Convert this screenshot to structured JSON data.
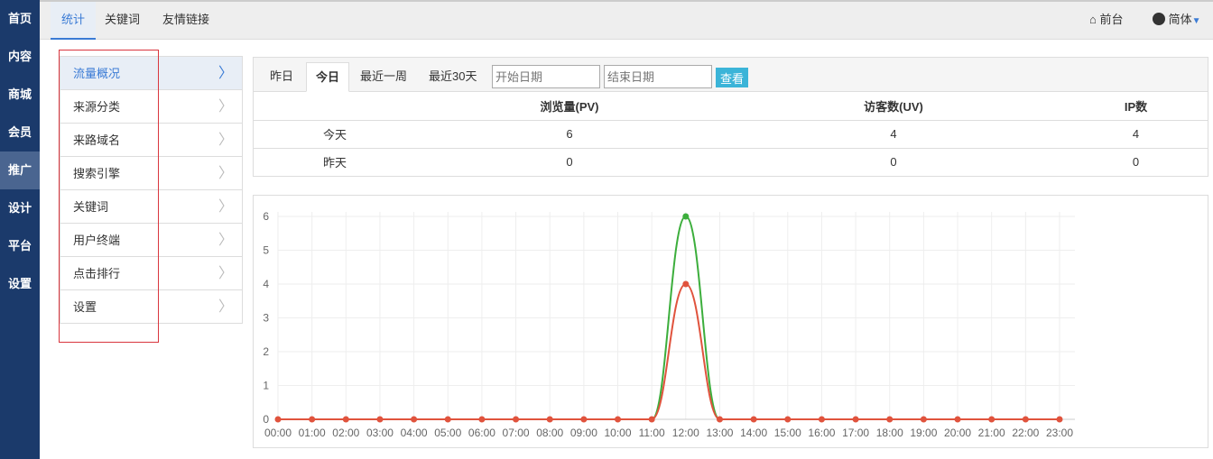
{
  "sidebar": {
    "items": [
      "首页",
      "内容",
      "商城",
      "会员",
      "推广",
      "设计",
      "平台",
      "设置"
    ],
    "active": 4
  },
  "topbar": {
    "tabs": [
      "统计",
      "关键词",
      "友情链接"
    ],
    "frontend": "前台",
    "language": "简体"
  },
  "menu": {
    "items": [
      "流量概况",
      "来源分类",
      "来路域名",
      "搜索引擎",
      "关键词",
      "用户终端",
      "点击排行",
      "设置"
    ]
  },
  "filter": {
    "tabs": [
      "昨日",
      "今日",
      "最近一周",
      "最近30天"
    ],
    "active": 1,
    "start_placeholder": "开始日期",
    "end_placeholder": "结束日期",
    "view_button": "查看"
  },
  "table": {
    "headers": [
      "",
      "浏览量(PV)",
      "访客数(UV)",
      "IP数"
    ],
    "rows": [
      [
        "今天",
        "6",
        "4",
        "4"
      ],
      [
        "昨天",
        "0",
        "0",
        "0"
      ]
    ]
  },
  "chart_data": {
    "type": "line",
    "x": [
      "00:00",
      "01:00",
      "02:00",
      "03:00",
      "04:00",
      "05:00",
      "06:00",
      "07:00",
      "08:00",
      "09:00",
      "10:00",
      "11:00",
      "12:00",
      "13:00",
      "14:00",
      "15:00",
      "16:00",
      "17:00",
      "18:00",
      "19:00",
      "20:00",
      "21:00",
      "22:00",
      "23:00"
    ],
    "ylim": [
      0,
      6
    ],
    "yticks": [
      0,
      1,
      2,
      3,
      4,
      5,
      6
    ],
    "grid": true,
    "series": [
      {
        "color": "#3cae3c",
        "values": [
          0,
          0,
          0,
          0,
          0,
          0,
          0,
          0,
          0,
          0,
          0,
          0,
          6,
          0,
          0,
          0,
          0,
          0,
          0,
          0,
          0,
          0,
          0,
          0
        ]
      },
      {
        "color": "#e0533d",
        "values": [
          0,
          0,
          0,
          0,
          0,
          0,
          0,
          0,
          0,
          0,
          0,
          0,
          4,
          0,
          0,
          0,
          0,
          0,
          0,
          0,
          0,
          0,
          0,
          0
        ]
      }
    ]
  }
}
